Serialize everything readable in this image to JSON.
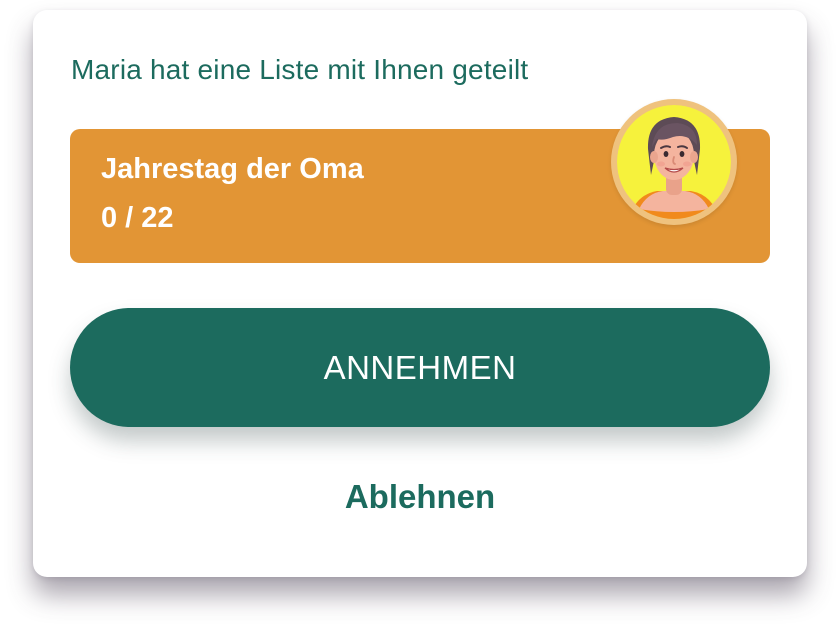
{
  "dialog": {
    "heading": "Maria hat eine Liste mit Ihnen geteilt"
  },
  "shared_list": {
    "title": "Jahrestag der Oma",
    "progress_text": "0 / 22",
    "progress_done": 0,
    "progress_total": 22,
    "card_color": "#e29535",
    "avatar_icon": "woman-avatar-icon",
    "avatar_background": "#f6f23c"
  },
  "actions": {
    "accept_label": "ANNEHMEN",
    "decline_label": "Ablehnen"
  },
  "colors": {
    "primary": "#1c6b5e",
    "background": "#ffffff"
  }
}
